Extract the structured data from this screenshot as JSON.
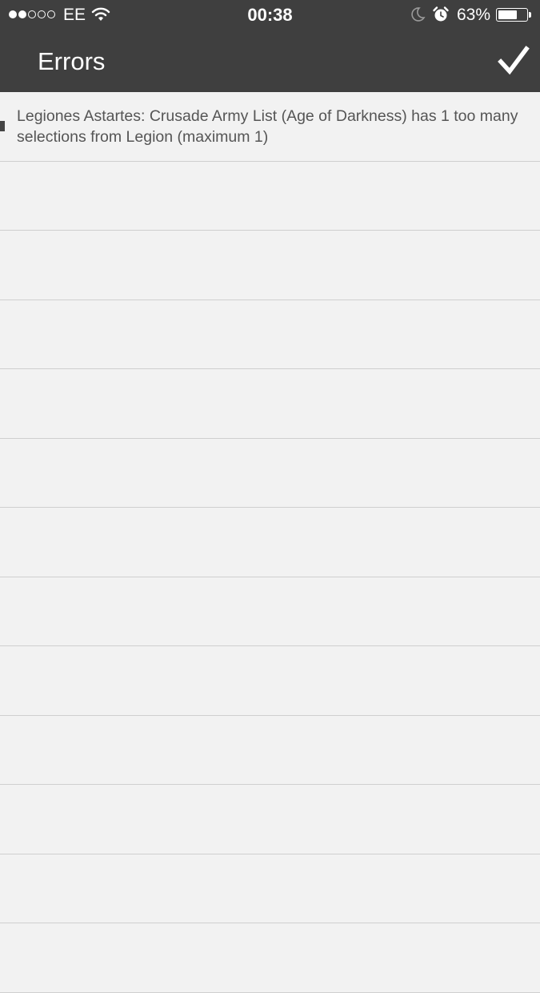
{
  "status_bar": {
    "signal_filled": 2,
    "signal_total": 5,
    "carrier": "EE",
    "time": "00:38",
    "battery_percent": "63%",
    "battery_level": 0.63,
    "icons": [
      "wifi-icon",
      "moon-icon",
      "alarm-icon",
      "battery-icon"
    ]
  },
  "nav": {
    "title": "Errors",
    "done_icon": "checkmark-icon"
  },
  "errors": [
    "Legiones Astartes: Crusade Army List (Age of Darkness) has 1 too many selections from Legion (maximum 1)"
  ],
  "colors": {
    "bar_bg": "#3f3f3f",
    "list_bg": "#f2f2f2",
    "separator": "#cfcfcf",
    "text": "#555555"
  }
}
